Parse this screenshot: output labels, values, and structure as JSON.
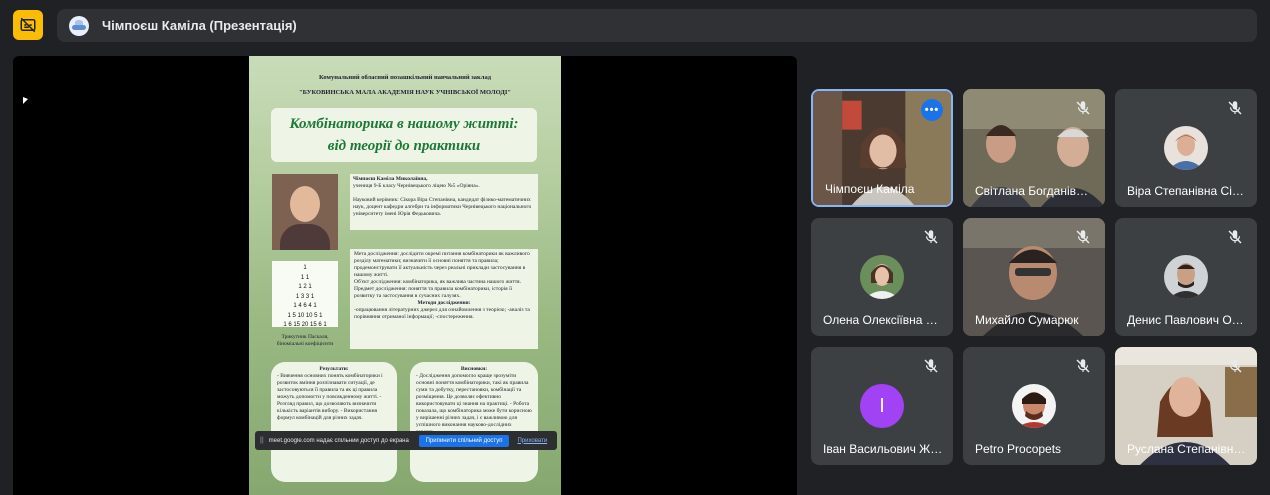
{
  "meeting": {
    "title": "Чімпоєш Каміла (Презентація)"
  },
  "slide": {
    "school": "Комунальний обласний позашкільний навчальний заклад",
    "academy": "\"БУКОВИНСЬКА МАЛА АКАДЕМІЯ НАУК УЧНІВСЬКОЇ МОЛОДІ\"",
    "title_line1": "Комбінаторика в нашому житті:",
    "title_line2": "від теорії до практики",
    "author_name": "Чімпоєш Каміла Миколаївна,",
    "author_info": "учениця 9-Б класу Чернівецького ліцею №5 «Оріяна».",
    "supervisor": "Науковий керівник: Сікора Віра Степанівна, кандидат фізико-математичних наук, доцент кафедри алгебри та інформатики Чернівецького національного університету імені Юрія Федьковича.",
    "pascal_rows": [
      "1",
      "1 1",
      "1 2 1",
      "1 3 3 1",
      "1 4 6 4 1",
      "1 5 10 10 5 1",
      "1 6 15 20 15 6 1"
    ],
    "pascal_caption": "Трикутник Паскаля, біноміальні коефіцієнти",
    "goal": "Мета дослідження: дослідити окремі питання комбінаторики як важливого розділу математики; визначити її основні поняття та правила; продемонструвати її актуальність через реальні приклади застосування в нашому житті.",
    "object": "Об'єкт дослідження: комбінаторика, як важлива частина нашого життя.",
    "subject": "Предмет дослідження: поняття та правила комбінаторики, історія її розвитку та застосування в сучасних галузях.",
    "methods_head": "Методи дослідження:",
    "methods": "-опрацювання літературних джерел для ознайомлення з теорією; -аналіз та порівняння отриманої інформації; -спостереження.",
    "results_head": "Результати:",
    "results": "- Вивчення основних понять комбінаторики і розвиток вміння розпізнавати ситуації, де застосовуються її правила та як ці правила можуть допомогти у повсякденному житті. - Розгляд правил, що дозволяють визначити кількість варіантів вибору. - Використання формул комбінацій для різних задач.",
    "conclusions_head": "Висновки:",
    "conclusions": "- Дослідження допомогло краще зрозуміти основні поняття комбінаторики, такі як правила суми та добутку, перестановки, комбінації та розміщення. Це дозволяє ефективно використовувати ці знання на практиці. - Робота показала, що комбінаторика може бути корисною у вирішенні різних задач, і є важливою для успішного виконання науково-дослідних завдань."
  },
  "share_bar": {
    "grip": "||",
    "text": "meet.google.com надає спільний доступ до екрана.",
    "stop": "Припинити спільний доступ",
    "hide": "Приховати"
  },
  "participants": [
    {
      "name": "Чімпоєш Каміла",
      "kind": "video",
      "muted": false,
      "active": true
    },
    {
      "name": "Світлана Богданів…",
      "kind": "video",
      "muted": true,
      "active": false
    },
    {
      "name": "Віра Степанівна Сі…",
      "kind": "avatar",
      "muted": true,
      "active": false
    },
    {
      "name": "Олена Олексіївна …",
      "kind": "avatar",
      "muted": true,
      "active": false
    },
    {
      "name": "Михайло Сумарюк",
      "kind": "video",
      "muted": true,
      "active": false
    },
    {
      "name": "Денис Павлович О…",
      "kind": "avatar",
      "muted": true,
      "active": false
    },
    {
      "name": "Іван Васильович Ж…",
      "kind": "letter",
      "letter": "І",
      "color": "#a142f4",
      "muted": true,
      "active": false
    },
    {
      "name": "Petro Procopets",
      "kind": "avatar",
      "muted": true,
      "active": false
    },
    {
      "name": "Руслана Степанівн…",
      "kind": "video",
      "muted": true,
      "active": false
    }
  ],
  "colors": {
    "accent": "#8ab4f8",
    "cc_button": "#fbbc04",
    "background": "#202124",
    "tile": "#3c4043",
    "stop_button": "#1a73e8"
  }
}
